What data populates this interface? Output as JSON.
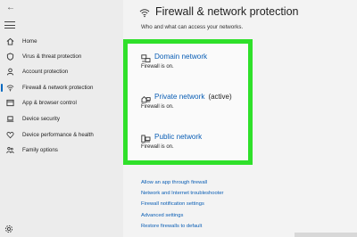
{
  "sidebar": {
    "items": [
      {
        "label": "Home",
        "icon": "home-icon"
      },
      {
        "label": "Virus & threat protection",
        "icon": "shield-icon"
      },
      {
        "label": "Account protection",
        "icon": "person-icon"
      },
      {
        "label": "Firewall & network protection",
        "icon": "wifi-icon",
        "active": true
      },
      {
        "label": "App & browser control",
        "icon": "browser-window-icon"
      },
      {
        "label": "Device security",
        "icon": "laptop-icon"
      },
      {
        "label": "Device performance & health",
        "icon": "heart-icon"
      },
      {
        "label": "Family options",
        "icon": "family-icon"
      }
    ]
  },
  "main": {
    "title": "Firewall & network protection",
    "subtitle": "Who and what can access your networks.",
    "networks": [
      {
        "title": "Domain network",
        "badge": "",
        "status": "Firewall is on.",
        "icon": "domain-network-icon"
      },
      {
        "title": "Private network",
        "badge": "(active)",
        "status": "Firewall is on.",
        "icon": "private-network-icon"
      },
      {
        "title": "Public network",
        "badge": "",
        "status": "Firewall is on.",
        "icon": "public-network-icon"
      }
    ],
    "links": [
      "Allow an app through firewall",
      "Network and Internet troubleshooter",
      "Firewall notification settings",
      "Advanced settings",
      "Restore firewalls to default"
    ]
  },
  "colors": {
    "highlight": "#2fe02a",
    "link": "#0a5eb5",
    "accent": "#0067c0"
  }
}
